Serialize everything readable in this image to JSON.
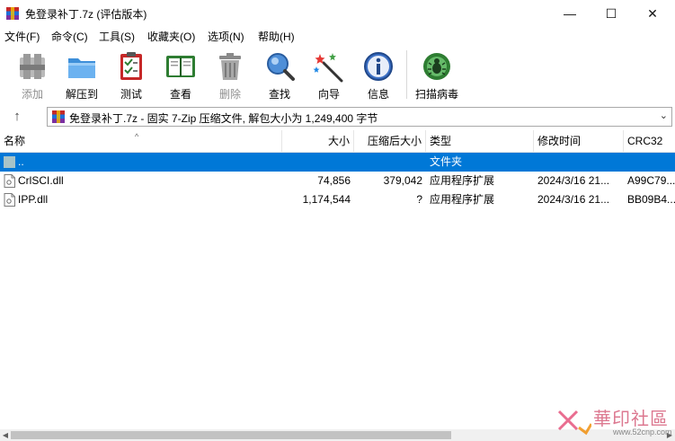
{
  "window": {
    "title": "免登录补丁.7z (评估版本)",
    "minimize_glyph": "—",
    "maximize_glyph": "☐",
    "close_glyph": "✕"
  },
  "menu": [
    {
      "label": "文件(F)"
    },
    {
      "label": "命令(C)"
    },
    {
      "label": "工具(S)"
    },
    {
      "label": "收藏夹(O)"
    },
    {
      "label": "选项(N)"
    },
    {
      "label": "帮助(H)"
    }
  ],
  "toolbar": [
    {
      "label": "添加",
      "icon": "add-archive-icon",
      "enabled": false
    },
    {
      "label": "解压到",
      "icon": "extract-folder-icon",
      "enabled": true
    },
    {
      "label": "测试",
      "icon": "test-clipboard-icon",
      "enabled": true
    },
    {
      "label": "查看",
      "icon": "view-book-icon",
      "enabled": true
    },
    {
      "label": "删除",
      "icon": "trash-icon",
      "enabled": false
    },
    {
      "label": "查找",
      "icon": "magnifier-icon",
      "enabled": true
    },
    {
      "label": "向导",
      "icon": "wizard-wand-icon",
      "enabled": true
    },
    {
      "label": "信息",
      "icon": "info-icon",
      "enabled": true
    },
    {
      "label": "扫描病毒",
      "icon": "virus-scan-icon",
      "enabled": true
    }
  ],
  "address": {
    "up_glyph": "↑",
    "path": "免登录补丁.7z - 固实 7-Zip 压缩文件, 解包大小为 1,249,400 字节",
    "dropdown_glyph": "⌄"
  },
  "columns": {
    "name": "名称",
    "size": "大小",
    "packed": "压缩后大小",
    "type": "类型",
    "modified": "修改时间",
    "crc": "CRC32",
    "sort_glyph": "^"
  },
  "rows": [
    {
      "name": "..",
      "size": "",
      "packed": "",
      "type": "文件夹",
      "modified": "",
      "crc": "",
      "selected": true,
      "icon": "parent-folder-icon"
    },
    {
      "name": "CrlSCI.dll",
      "size": "74,856",
      "packed": "379,042",
      "type": "应用程序扩展",
      "modified": "2024/3/16 21...",
      "crc": "A99C79...",
      "selected": false,
      "icon": "dll-file-icon"
    },
    {
      "name": "IPP.dll",
      "size": "1,174,544",
      "packed": "?",
      "type": "应用程序扩展",
      "modified": "2024/3/16 21...",
      "crc": "BB09B4...",
      "selected": false,
      "icon": "dll-file-icon"
    }
  ],
  "scrollbar": {
    "left_glyph": "◀",
    "right_glyph": "▶"
  },
  "watermark": {
    "title": "華印社區",
    "url": "www.52cnp.com"
  },
  "colors": {
    "selection": "#0078d7",
    "header_border": "#e5e5e5"
  }
}
